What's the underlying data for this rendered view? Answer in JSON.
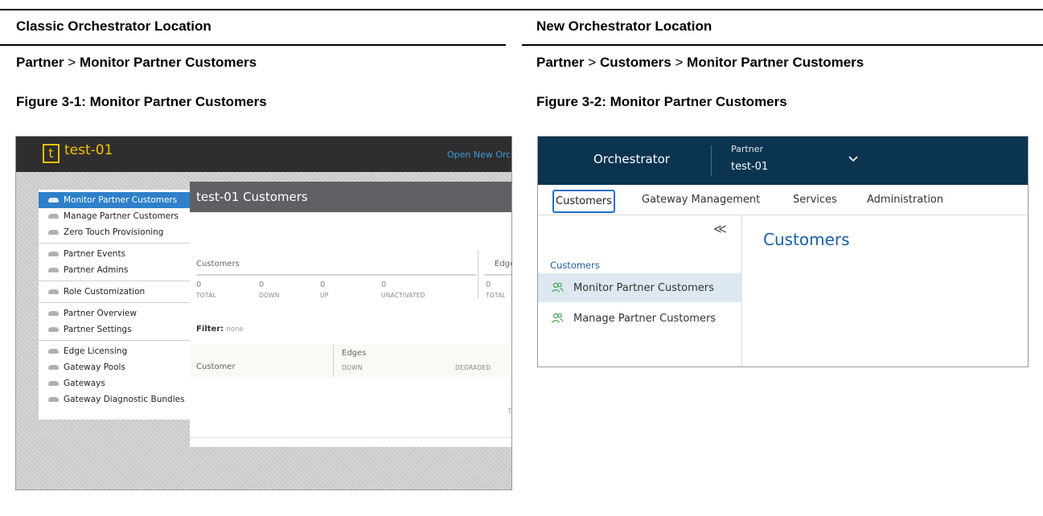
{
  "doc": {
    "classic_header": "Classic Orchestrator Location",
    "new_header": "New Orchestrator Location",
    "classic_path": [
      "Partner",
      "Monitor Partner Customers"
    ],
    "new_path": [
      "Partner",
      "Customers",
      "Monitor Partner Customers"
    ],
    "path_separator": ">",
    "classic_caption": "Figure 3-1: Monitor Partner Customers",
    "new_caption": "Figure 3-2: Monitor Partner Customers"
  },
  "classic": {
    "logo": "t",
    "title": "test-01",
    "open_link": "Open New Orch",
    "nav": [
      [
        "Monitor Partner Customers",
        "Manage Partner Customers",
        "Zero Touch Provisioning"
      ],
      [
        "Partner Events",
        "Partner Admins"
      ],
      [
        "Role Customization"
      ],
      [
        "Partner Overview",
        "Partner Settings"
      ],
      [
        "Edge Licensing",
        "Gateway Pools",
        "Gateways",
        "Gateway Diagnostic Bundles"
      ]
    ],
    "active_item": "Monitor Partner Customers",
    "main_title": "test-01 Customers",
    "customers_label": "Customers",
    "edges_label": "Edges",
    "stats": [
      {
        "value": "0",
        "label": "TOTAL"
      },
      {
        "value": "0",
        "label": "DOWN"
      },
      {
        "value": "0",
        "label": "UP"
      },
      {
        "value": "0",
        "label": "UNACTIVATED"
      },
      {
        "value": "0",
        "label": "TOTAL"
      }
    ],
    "filter_label": "Filter:",
    "filter_value": "none",
    "table_customer": "Customer",
    "table_edges": "Edges",
    "table_down": "DOWN",
    "table_degraded": "DEGRADED",
    "trailing_char": "t",
    "accent_color": "#f2c200",
    "active_color": "#2f80c9"
  },
  "newui": {
    "brand": "Orchestrator",
    "partner_label": "Partner",
    "partner_name": "test-01",
    "tabs": [
      "Customers",
      "Gateway Management",
      "Services",
      "Administration"
    ],
    "active_tab": "Customers",
    "collapse_glyph": "≪",
    "section_heading": "Customers",
    "side_items": [
      "Monitor Partner Customers",
      "Manage Partner Customers"
    ],
    "active_side_item": "Monitor Partner Customers",
    "content_title": "Customers",
    "topbar_color": "#0b3450",
    "link_color": "#1b5fa8",
    "icon_color": "#3fa34d"
  }
}
